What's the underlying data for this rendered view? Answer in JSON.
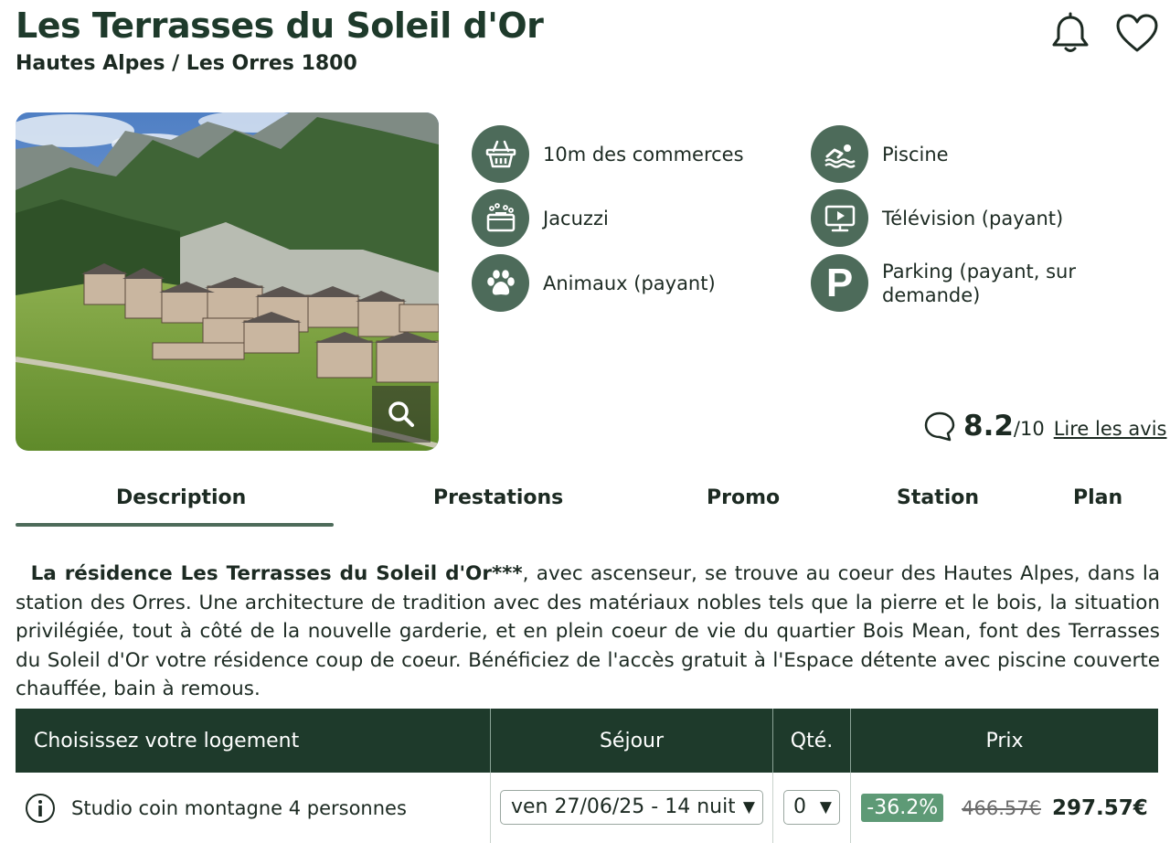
{
  "header": {
    "title": "Les Terrasses du Soleil d'Or",
    "subtitle": "Hautes Alpes / Les Orres 1800"
  },
  "icons": {
    "bell": "bell-icon",
    "heart": "heart-icon",
    "zoom": "search-icon"
  },
  "amenities": [
    {
      "label": "10m des commerces",
      "icon": "basket-icon"
    },
    {
      "label": "Piscine",
      "icon": "swimmer-icon"
    },
    {
      "label": "Jacuzzi",
      "icon": "jacuzzi-icon"
    },
    {
      "label": "Télévision (payant)",
      "icon": "tv-icon"
    },
    {
      "label": "Animaux (payant)",
      "icon": "paw-icon"
    },
    {
      "label": "Parking (payant, sur demande)",
      "icon": "parking-icon",
      "glyph": "P"
    }
  ],
  "rating": {
    "score": "8.2",
    "scale": "/10",
    "link": "Lire les avis"
  },
  "tabs": [
    {
      "label": "Description",
      "active": true
    },
    {
      "label": "Prestations"
    },
    {
      "label": "Promo"
    },
    {
      "label": "Station"
    },
    {
      "label": "Plan"
    }
  ],
  "description": {
    "bold_intro": "La résidence Les Terrasses du Soleil d'Or***",
    "text": ", avec ascenseur, se trouve au coeur des Hautes Alpes, dans la station des Orres. Une architecture de tradition avec des matériaux nobles tels que la pierre et le bois, la situation privilégiée, tout à côté de la nouvelle garderie, et en plein coeur de vie du quartier Bois Mean, font des Terrasses du Soleil d'Or votre résidence coup de coeur. Bénéficiez de l'accès gratuit à l'Espace détente avec piscine couverte chauffée, bain à remous."
  },
  "table": {
    "headers": [
      "Choisissez votre logement",
      "Séjour",
      "Qté.",
      "Prix"
    ],
    "rows": [
      {
        "name": "Studio coin montagne 4 personnes",
        "stay": "ven 27/06/25 - 14 nuits",
        "qty": "0",
        "discount": "-36.2%",
        "old_price": "466.57€",
        "new_price": "297.57€"
      }
    ]
  },
  "colors": {
    "primary_dark": "#1e3a2b",
    "icon_circle": "#4d6b5a",
    "discount_badge": "#5e9a76"
  }
}
